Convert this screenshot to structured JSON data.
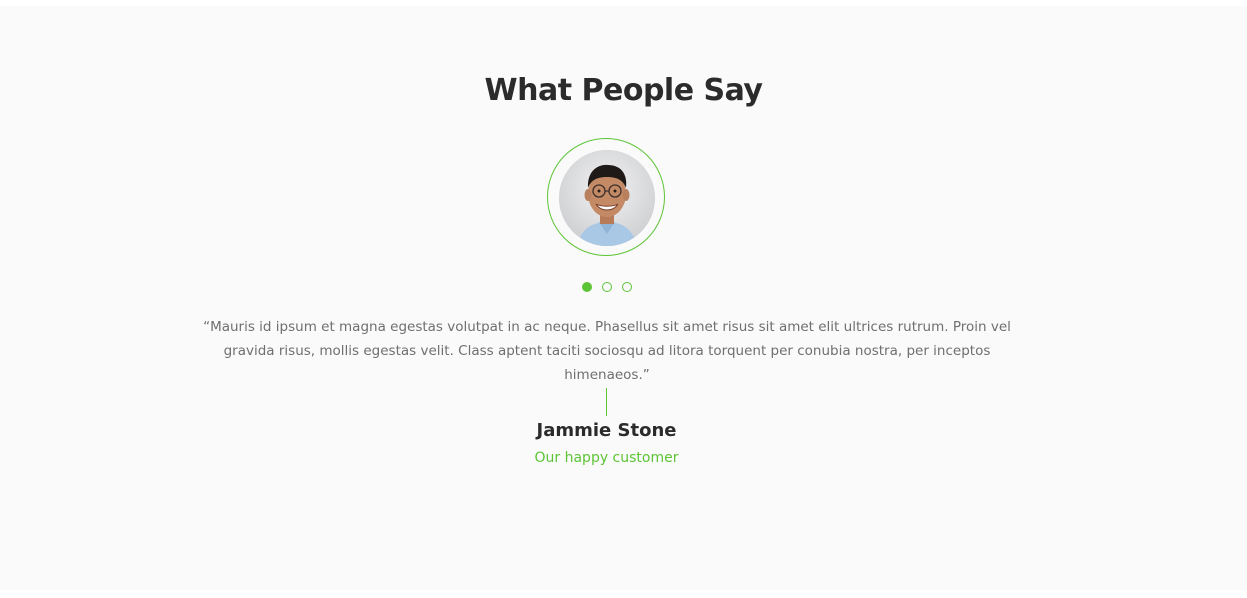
{
  "section": {
    "title": "What People Say",
    "accent_color": "#5ec437"
  },
  "testimonial": {
    "avatar": "person-avatar",
    "quote": "“Mauris id ipsum et magna egestas volutpat in ac neque. Phasellus sit amet risus sit amet elit ultrices rutrum. Proin vel gravida risus, mollis egestas velit. Class aptent taciti sociosqu ad litora torquent per conubia nostra, per inceptos himenaeos.”",
    "name": "Jammie Stone",
    "role": "Our happy customer"
  },
  "carousel": {
    "slide_count": 3,
    "active_index": 0
  }
}
